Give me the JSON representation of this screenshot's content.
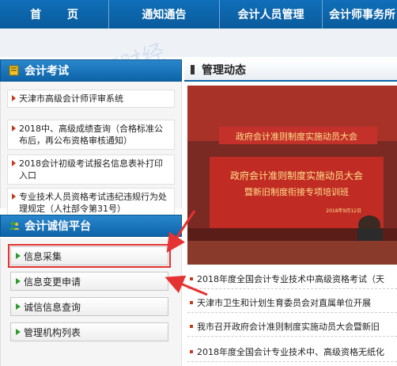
{
  "nav": {
    "home": "首 页",
    "notice": "通知通告",
    "staff": "会计人员管理",
    "firm": "会计师事务所"
  },
  "exam": {
    "title": "会计考试",
    "items": [
      "天津市高级会计师评审系统",
      "2018中、高级成绩查询（合格标准公布后，再公布资格审核通知）",
      "2018会计初级考试报名信息表补打印入口",
      "专业技术人员资格考试违纪违规行为处理规定（人社部令第31号）"
    ]
  },
  "credit": {
    "title": "会计诚信平台",
    "items": [
      "信息采集",
      "信息变更申请",
      "诚信信息查询",
      "管理机构列表"
    ]
  },
  "news": {
    "title": "管理动态",
    "photo": {
      "banner_top": "政府会计准则制度实施动员大会",
      "banner_main_1": "政府会计准则制度实施动员大会",
      "banner_main_2": "暨新旧制度衔接专项培训班",
      "banner_date": "2018年9月12日"
    },
    "items": [
      "2018年度全国会计专业技术中高级资格考试（天",
      "天津市卫生和计划生育委员会对直属单位开展",
      "我市召开政府会计准则制度实施动员大会暨新旧",
      "2018年度全国会计专业技术中、高级资格无纸化"
    ]
  },
  "watermark": "高顿财经",
  "colors": {
    "nav_blue": "#0d64a8",
    "arrow_red": "#e53232",
    "stage_red": "#b3241c"
  }
}
